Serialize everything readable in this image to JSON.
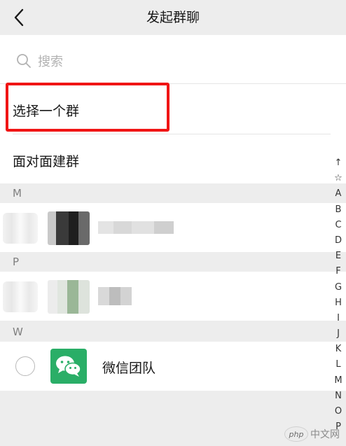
{
  "header": {
    "title": "发起群聊",
    "back_icon": "chevron-left-icon"
  },
  "search": {
    "icon": "search-icon",
    "placeholder": "搜索"
  },
  "options": {
    "select_group": "选择一个群",
    "face_to_face": "面对面建群"
  },
  "highlight_color": "#f01515",
  "sections": [
    {
      "letter": "M",
      "contacts": [
        {
          "name": "",
          "blurred": true
        }
      ]
    },
    {
      "letter": "P",
      "contacts": [
        {
          "name": "",
          "blurred": true
        }
      ]
    },
    {
      "letter": "W",
      "contacts": [
        {
          "name": "微信团队",
          "blurred": false,
          "avatar_icon": "wechat-logo-icon",
          "avatar_color": "#2aae67"
        }
      ]
    }
  ],
  "index_bar": [
    "↑",
    "☆",
    "A",
    "B",
    "C",
    "D",
    "E",
    "F",
    "G",
    "H",
    "I",
    "J",
    "K",
    "L",
    "M",
    "N",
    "O",
    "P"
  ],
  "watermark": {
    "logo": "php",
    "text": "中文网"
  }
}
